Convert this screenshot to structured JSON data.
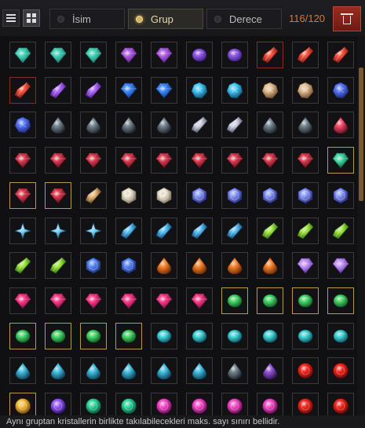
{
  "toolbar": {
    "sort_options": [
      {
        "label": "İsim",
        "active": false
      },
      {
        "label": "Grup",
        "active": true
      },
      {
        "label": "Derece",
        "active": false
      }
    ],
    "count": "116/120"
  },
  "footer_text": "Aynı gruptan kristallerin birlikte takılabilecekleri maks. sayı sınırı bellidir.",
  "colors": {
    "accent_gold": "#b89a4e",
    "count_orange": "#d07a3a",
    "delete_red": "#9a2b22"
  },
  "inventory": {
    "columns": 10,
    "rows": [
      [
        "teal-gem",
        "teal-gem",
        "teal-gem",
        "violet-gem",
        "violet-gem",
        "violet-oval-gem",
        "violet-oval-gem",
        "red-shard",
        "red-shard",
        "red-shard"
      ],
      [
        "red-shard",
        "purple-shard",
        "purple-shard",
        "blue-gem",
        "blue-gem",
        "cyan-rune",
        "cyan-rune",
        "bronze-rune",
        "bronze-rune",
        "blue-rune"
      ],
      [
        "blue-rune",
        "dark-drop",
        "dark-drop",
        "dark-drop",
        "dark-drop",
        "silver-shard",
        "silver-shard",
        "dark-drop",
        "dark-drop",
        "crimson-drop"
      ],
      [
        "crimson-gem",
        "crimson-gem",
        "crimson-gem",
        "crimson-gem",
        "crimson-gem",
        "crimson-gem",
        "crimson-gem",
        "crimson-gem",
        "crimson-gem",
        "green-cluster"
      ],
      [
        "crimson-gem",
        "crimson-gem",
        "amber-shard",
        "white-hex",
        "white-hex",
        "indigo-hex",
        "indigo-hex",
        "indigo-hex",
        "indigo-hex",
        "indigo-hex"
      ],
      [
        "sky-star",
        "sky-star",
        "sky-star",
        "sky-crystal",
        "sky-crystal",
        "sky-crystal",
        "sky-crystal",
        "lime-crystal",
        "lime-crystal",
        "lime-crystal"
      ],
      [
        "lime-crystal",
        "lime-crystal",
        "blue-hex",
        "blue-hex",
        "orange-drop",
        "orange-drop",
        "orange-drop",
        "orange-drop",
        "lavender-gem",
        "lavender-gem"
      ],
      [
        "magenta-gem",
        "magenta-gem",
        "magenta-gem",
        "magenta-gem",
        "magenta-gem",
        "magenta-gem",
        "green-oval",
        "green-oval",
        "green-oval",
        "green-oval"
      ],
      [
        "green-oval",
        "green-oval",
        "green-oval",
        "green-oval",
        "aqua-oval",
        "aqua-oval",
        "aqua-oval",
        "aqua-oval",
        "aqua-oval",
        "aqua-oval"
      ],
      [
        "aqua-drop",
        "aqua-drop",
        "aqua-drop",
        "aqua-drop",
        "aqua-drop",
        "aqua-drop",
        "dark-drop",
        "purple-drop",
        "red-round",
        "red-round"
      ],
      [
        "gold-round",
        "purple-round",
        "emerald-round",
        "emerald-round",
        "pink-round",
        "pink-round",
        "pink-round",
        "pink-round",
        "red-round",
        "red-round"
      ]
    ],
    "frames": [
      [
        "n",
        "n",
        "n",
        "n",
        "n",
        "n",
        "n",
        "r",
        "n",
        "n"
      ],
      [
        "r",
        "n",
        "n",
        "n",
        "n",
        "n",
        "n",
        "n",
        "n",
        "n"
      ],
      [
        "n",
        "n",
        "n",
        "n",
        "n",
        "n",
        "n",
        "n",
        "n",
        "n"
      ],
      [
        "n",
        "n",
        "n",
        "n",
        "n",
        "n",
        "n",
        "n",
        "n",
        "g"
      ],
      [
        "g",
        "g",
        "n",
        "n",
        "n",
        "n",
        "n",
        "n",
        "n",
        "n"
      ],
      [
        "n",
        "n",
        "n",
        "n",
        "n",
        "n",
        "n",
        "n",
        "n",
        "n"
      ],
      [
        "n",
        "n",
        "n",
        "n",
        "n",
        "n",
        "n",
        "n",
        "n",
        "n"
      ],
      [
        "n",
        "n",
        "n",
        "n",
        "n",
        "n",
        "g",
        "g",
        "g",
        "g"
      ],
      [
        "g",
        "g",
        "g",
        "g",
        "n",
        "n",
        "n",
        "n",
        "n",
        "n"
      ],
      [
        "n",
        "n",
        "n",
        "n",
        "n",
        "n",
        "n",
        "n",
        "n",
        "n"
      ],
      [
        "g",
        "n",
        "n",
        "n",
        "n",
        "n",
        "n",
        "n",
        "n",
        "n"
      ]
    ]
  }
}
